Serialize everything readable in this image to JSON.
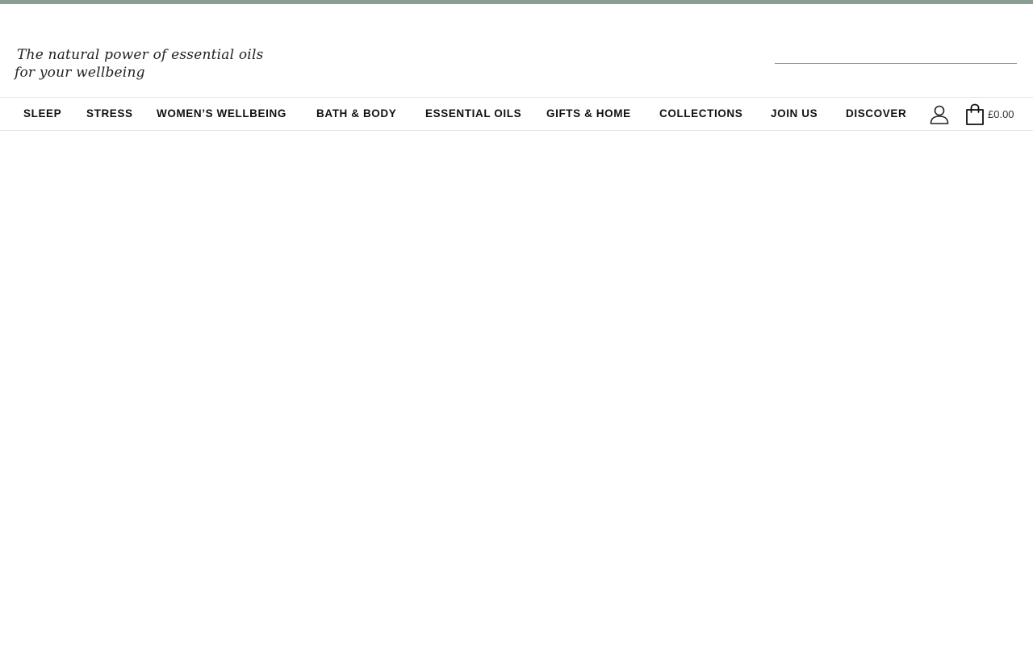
{
  "colors": {
    "top_strip": "#8a9e92",
    "text": "#111111",
    "border": "#e4e4e4"
  },
  "header": {
    "tagline_line1": "The natural power of essential oils",
    "tagline_line2": "for your wellbeing",
    "search": {
      "value": "",
      "placeholder": ""
    }
  },
  "nav": {
    "items": [
      {
        "label": "SLEEP"
      },
      {
        "label": "STRESS"
      },
      {
        "label": "WOMEN’S WELLBEING"
      },
      {
        "label": "BATH & BODY"
      },
      {
        "label": "ESSENTIAL OILS"
      },
      {
        "label": "GIFTS & HOME"
      },
      {
        "label": "COLLECTIONS"
      },
      {
        "label": "JOIN US"
      },
      {
        "label": "DISCOVER"
      }
    ],
    "account_icon": "user-icon",
    "cart_icon": "shopping-bag-icon",
    "cart_total": "£0.00"
  }
}
